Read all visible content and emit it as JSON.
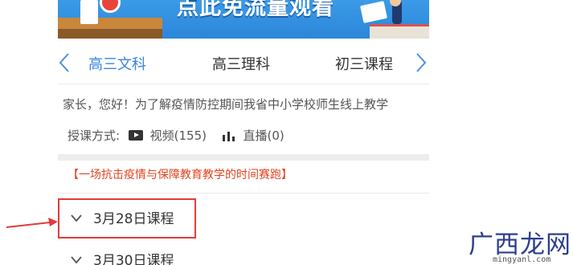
{
  "banner": {
    "title": "点此免流量观看"
  },
  "tabs": [
    {
      "label": "高三文科",
      "active": true
    },
    {
      "label": "高三理科",
      "active": false
    },
    {
      "label": "初三课程",
      "active": false
    }
  ],
  "intro": {
    "text": "家长，您好！为了解疫情防控期间我省中小学校师生线上教学"
  },
  "methods": {
    "label": "授课方式:",
    "video": "视频(155)",
    "live": "直播(0)"
  },
  "promo": {
    "text": "【一场抗击疫情与保障教育教学的时间赛跑】"
  },
  "courses": [
    {
      "label": "3月28日课程",
      "highlighted": true
    },
    {
      "label": "3月30日课程",
      "highlighted": false
    }
  ],
  "watermark": {
    "text": "广西龙网",
    "url": "mingyanl.com"
  },
  "colors": {
    "accent": "#3a86e0",
    "promo_red": "#e2431e",
    "highlight_border": "#e23b3b",
    "banner_blue": "#2f8fe0"
  },
  "icons": {
    "prev": "chevron-left-icon",
    "next": "chevron-right-icon",
    "video": "play-icon",
    "live": "bar-chart-icon",
    "course": "chevron-down-icon"
  }
}
